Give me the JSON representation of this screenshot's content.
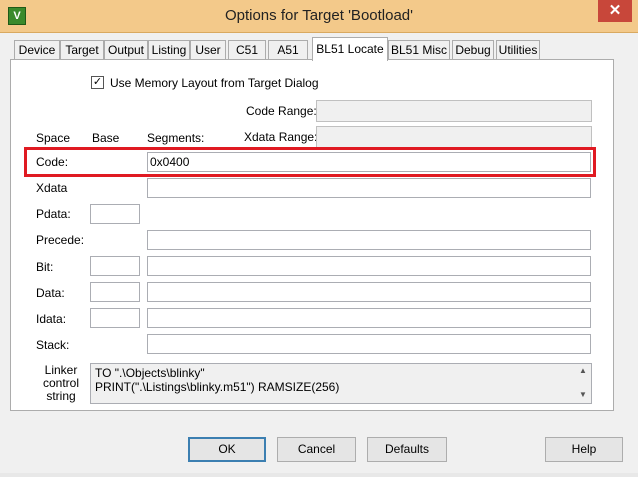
{
  "window": {
    "title": "Options for Target 'Bootload'",
    "app_icon": "uvision-icon",
    "close_glyph": "✕"
  },
  "tabs": [
    {
      "label": "Device"
    },
    {
      "label": "Target"
    },
    {
      "label": "Output"
    },
    {
      "label": "Listing"
    },
    {
      "label": "User"
    },
    {
      "label": "C51"
    },
    {
      "label": "A51"
    },
    {
      "label": "BL51 Locate",
      "active": true
    },
    {
      "label": "BL51 Misc"
    },
    {
      "label": "Debug"
    },
    {
      "label": "Utilities"
    }
  ],
  "options": {
    "use_memory_layout_checked": true,
    "use_memory_layout_label": "Use Memory Layout from Target Dialog",
    "check_glyph": "✓"
  },
  "ranges": {
    "code_range_label": "Code Range:",
    "code_range_value": "",
    "xdata_range_label": "Xdata Range:",
    "xdata_range_value": ""
  },
  "headers": {
    "space": "Space",
    "base": "Base",
    "segments": "Segments:"
  },
  "rows": {
    "code": {
      "label": "Code:",
      "segments": "0x0400"
    },
    "xdata": {
      "label": "Xdata",
      "segments": ""
    },
    "pdata": {
      "label": "Pdata:",
      "base": ""
    },
    "precede": {
      "label": "Precede:",
      "segments": ""
    },
    "bit": {
      "label": "Bit:",
      "base": "",
      "segments": ""
    },
    "data": {
      "label": "Data:",
      "base": "",
      "segments": ""
    },
    "idata": {
      "label": "Idata:",
      "base": "",
      "segments": ""
    },
    "stack": {
      "label": "Stack:",
      "segments": ""
    }
  },
  "linker": {
    "label_line1": "Linker",
    "label_line2": "control",
    "label_line3": "string",
    "line1": "TO \".\\Objects\\blinky\"",
    "line2": "PRINT(\".\\Listings\\blinky.m51\") RAMSIZE(256)",
    "scroll_up": "▲",
    "scroll_down": "▼"
  },
  "buttons": {
    "ok": "OK",
    "cancel": "Cancel",
    "defaults": "Defaults",
    "help": "Help"
  },
  "colors": {
    "titlebar": "#f3c98a",
    "highlight": "#e01a22",
    "close_button": "#c8473a"
  }
}
